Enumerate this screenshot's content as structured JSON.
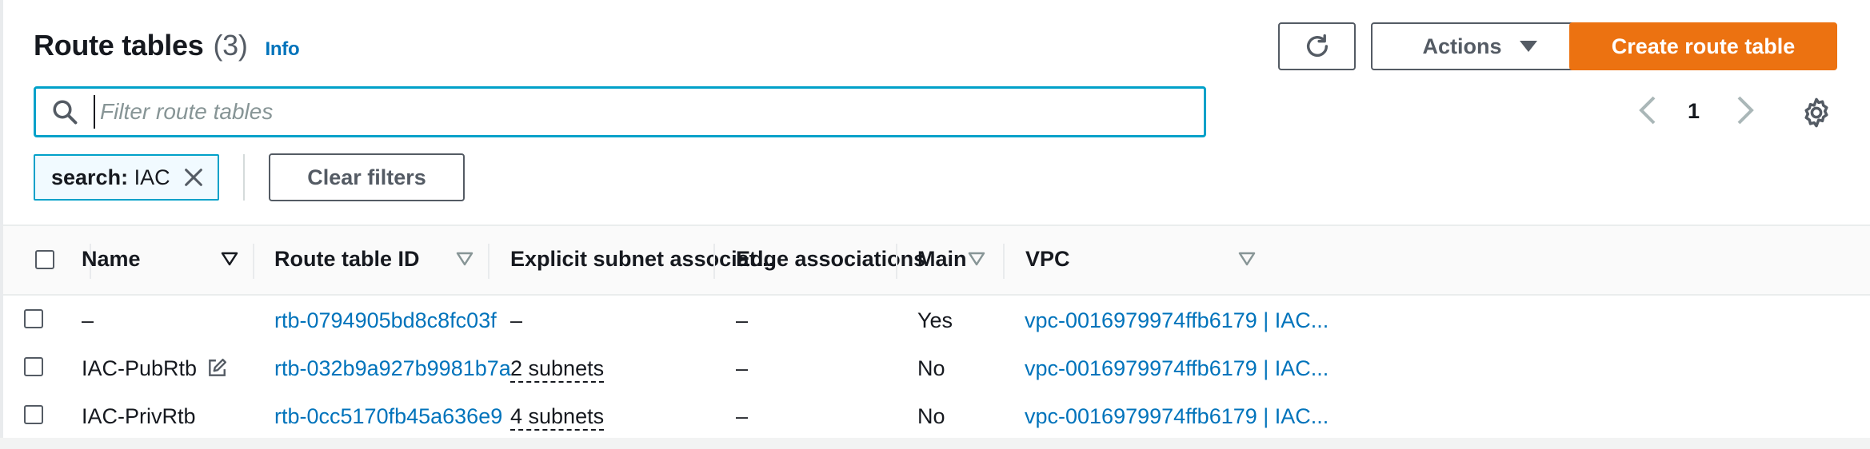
{
  "header": {
    "title": "Route tables",
    "count": "(3)",
    "info_link": "Info",
    "actions_label": "Actions",
    "create_label": "Create route table"
  },
  "search": {
    "placeholder": "Filter route tables",
    "value": ""
  },
  "filter_token": {
    "key": "search:",
    "value": "IAC"
  },
  "clear_filters_label": "Clear filters",
  "pagination": {
    "current_page": "1"
  },
  "table": {
    "columns": [
      {
        "label": "Name",
        "sortable": true
      },
      {
        "label": "Route table ID",
        "sortable": true
      },
      {
        "label": "Explicit subnet associat...",
        "sortable": false
      },
      {
        "label": "Edge associations",
        "sortable": false
      },
      {
        "label": "Main",
        "sortable": true
      },
      {
        "label": "VPC",
        "sortable": true
      }
    ],
    "rows": [
      {
        "name": "–",
        "route_table_id": "rtb-0794905bd8c8fc03f",
        "explicit_subnet": "–",
        "edge": "–",
        "main": "Yes",
        "vpc": "vpc-0016979974ffb6179 | IAC..."
      },
      {
        "name": "IAC-PubRtb",
        "route_table_id": "rtb-032b9a927b9981b7a",
        "explicit_subnet": "2 subnets",
        "edge": "–",
        "main": "No",
        "vpc": "vpc-0016979974ffb6179 | IAC..."
      },
      {
        "name": "IAC-PrivRtb",
        "route_table_id": "rtb-0cc5170fb45a636e9",
        "explicit_subnet": "4 subnets",
        "edge": "–",
        "main": "No",
        "vpc": "vpc-0016979974ffb6179 | IAC..."
      }
    ]
  },
  "colors": {
    "primary_button": "#ec7211",
    "link": "#0073bb",
    "focus": "#00a1c9"
  },
  "icons": [
    "refresh-icon",
    "caret-down-icon",
    "search-icon",
    "close-icon",
    "chevron-left-icon",
    "chevron-right-icon",
    "gear-icon",
    "sort-icon",
    "edit-icon"
  ]
}
